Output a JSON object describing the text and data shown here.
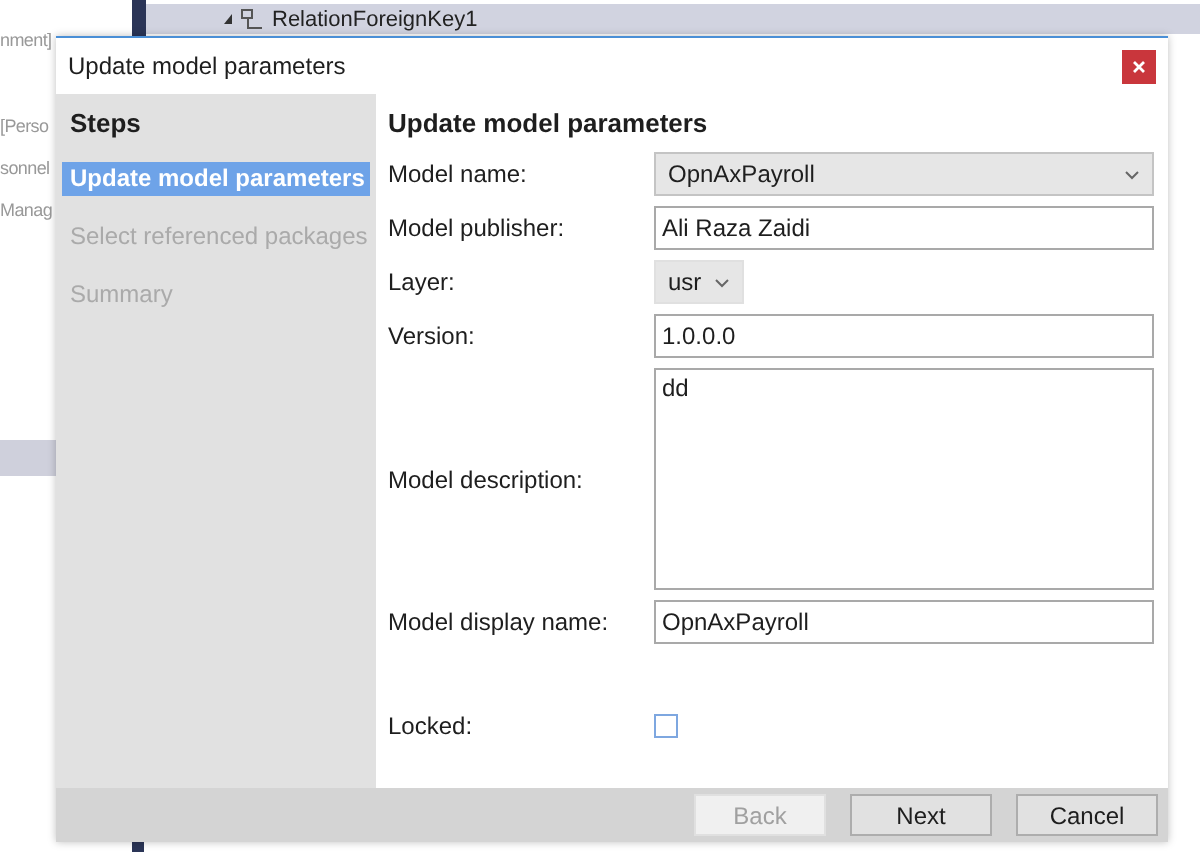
{
  "background": {
    "tree_items": [
      {
        "label": "RelationForeignKey1"
      }
    ],
    "side_texts": [
      "nment]",
      "[Perso",
      "sonnel",
      "Manag"
    ]
  },
  "dialog": {
    "title": "Update model parameters",
    "steps": {
      "heading": "Steps",
      "items": [
        {
          "label": "Update model parameters",
          "selected": true,
          "disabled": false
        },
        {
          "label": "Select referenced packages",
          "selected": false,
          "disabled": true
        },
        {
          "label": "Summary",
          "selected": false,
          "disabled": true
        }
      ]
    },
    "heading": "Update model parameters",
    "fields": [
      {
        "kind": "dropdown",
        "label": "Model name:",
        "value": "OpnAxPayroll"
      },
      {
        "kind": "text",
        "label": "Model publisher:",
        "value": "Ali Raza Zaidi"
      },
      {
        "kind": "small-dropdown",
        "label": "Layer:",
        "value": "usr"
      },
      {
        "kind": "text",
        "label": "Version:",
        "value": "1.0.0.0"
      },
      {
        "kind": "multiline",
        "label": "Model description:",
        "value": "dd"
      },
      {
        "kind": "text",
        "label": "Model display name:",
        "value": "OpnAxPayroll"
      },
      {
        "kind": "checkbox",
        "label": "Locked:",
        "checked": false
      }
    ],
    "buttons": [
      {
        "label": "Back",
        "disabled": true
      },
      {
        "label": "Next",
        "disabled": false
      },
      {
        "label": "Cancel",
        "disabled": false
      }
    ]
  }
}
